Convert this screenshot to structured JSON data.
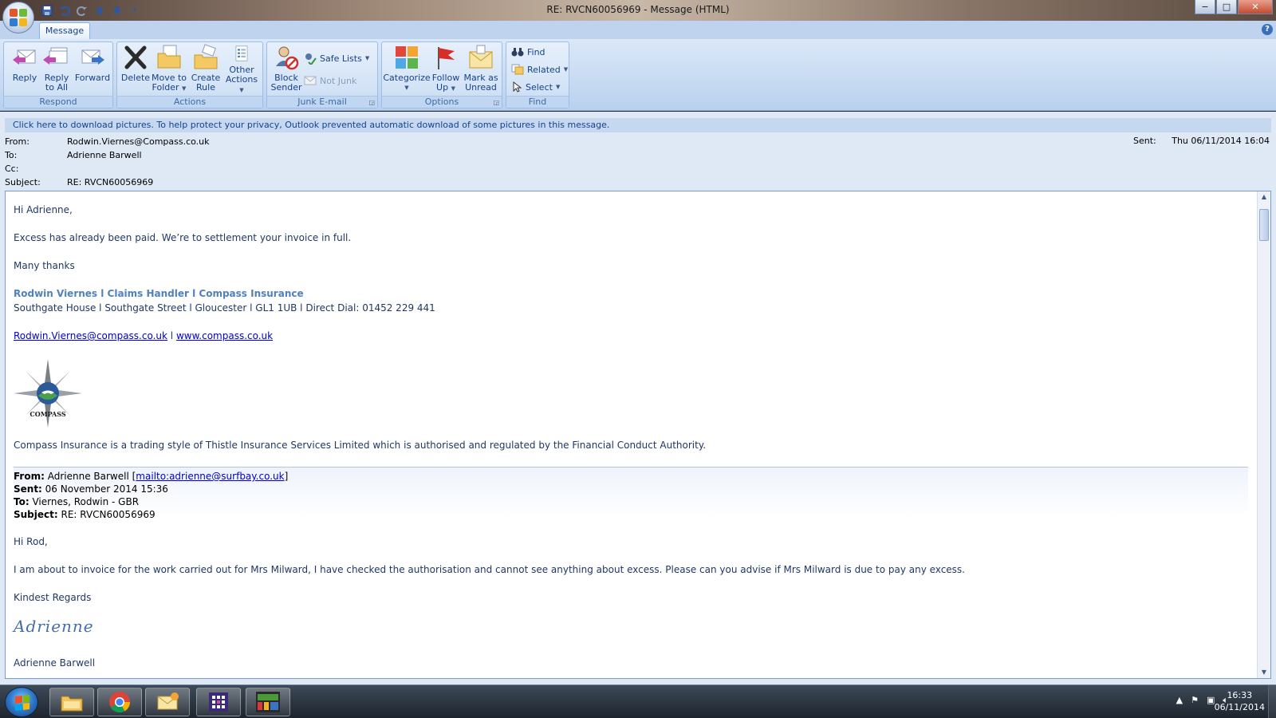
{
  "window": {
    "title": "RE: RVCN60056969 - Message (HTML)",
    "minimize": "−",
    "maximize": "□",
    "close": "✕"
  },
  "ribbon": {
    "tab": "Message",
    "groups": {
      "respond": {
        "label": "Respond",
        "reply": "Reply",
        "reply_all_1": "Reply",
        "reply_all_2": "to All",
        "forward": "Forward"
      },
      "actions": {
        "label": "Actions",
        "delete": "Delete",
        "move_1": "Move to",
        "move_2": "Folder",
        "create_rule_1": "Create",
        "create_rule_2": "Rule",
        "other_1": "Other",
        "other_2": "Actions"
      },
      "junk": {
        "label": "Junk E-mail",
        "block_1": "Block",
        "block_2": "Sender",
        "safe_lists": "Safe Lists",
        "not_junk": "Not Junk"
      },
      "options": {
        "label": "Options",
        "categorize": "Categorize",
        "follow_1": "Follow",
        "follow_2": "Up",
        "mark_1": "Mark as",
        "mark_2": "Unread"
      },
      "find": {
        "label": "Find",
        "find": "Find",
        "related": "Related",
        "select": "Select"
      }
    }
  },
  "infobar": "Click here to download pictures. To help protect your privacy, Outlook prevented automatic download of some pictures in this message.",
  "headers": {
    "from_label": "From:",
    "from": "Rodwin.Viernes@Compass.co.uk",
    "to_label": "To:",
    "to": "Adrienne Barwell",
    "cc_label": "Cc:",
    "cc": "",
    "subject_label": "Subject:",
    "subject": "RE: RVCN60056969",
    "sent_label": "Sent:",
    "sent": "Thu 06/11/2014 16:04"
  },
  "body": {
    "greeting": "Hi Adrienne,",
    "line1": "Excess has already been paid. We’re to settlement your invoice in full.",
    "thanks": "Many thanks",
    "sig_name": "Rodwin Viernes l Claims Handler l Compass Insurance",
    "sig_address": "Southgate House l Southgate Street l Gloucester l GL1 1UB l Direct Dial: 01452 229 441",
    "sig_email": "Rodwin.Viernes@compass.co.uk",
    "sig_sep": " l ",
    "sig_web": "www.compass.co.uk",
    "logo_text": "COMPASS",
    "disclaimer": "Compass Insurance is a trading style of Thistle Insurance Services Limited which is authorised and regulated by the Financial Conduct Authority.",
    "quoted": {
      "from_label": "From:",
      "from_name": " Adrienne Barwell [",
      "from_mailto": "mailto:adrienne@surfbay.co.uk",
      "from_close": "]",
      "sent_label": "Sent:",
      "sent": " 06 November 2014 15:36",
      "to_label": "To:",
      "to": " Viernes, Rodwin - GBR",
      "subject_label": "Subject:",
      "subject": " RE: RVCN60056969"
    },
    "reply_greeting": "Hi Rod,",
    "reply_line": "I am about to invoice for the work carried out for Mrs Milward, I have checked the authorisation and cannot see anything about excess.  Please can you advise if Mrs Milward is due to pay any excess.",
    "regards": "Kindest Regards",
    "handwritten": "Adrienne",
    "reply_name": "Adrienne Barwell"
  },
  "taskbar": {
    "time": "16:33",
    "date": "06/11/2014"
  },
  "colors": {
    "ribbon_text": "#15428b",
    "body_text": "#1f3864",
    "signature": "#4f81bd"
  }
}
